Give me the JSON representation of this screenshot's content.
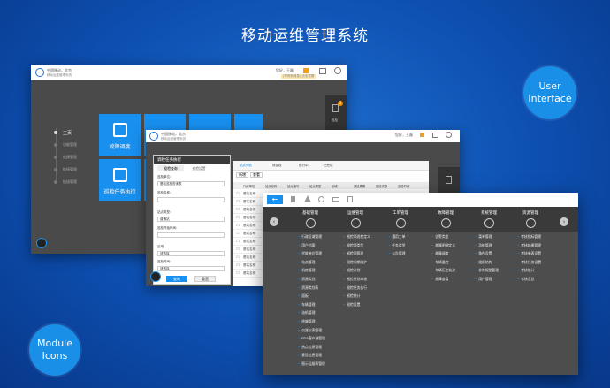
{
  "headline": "移动运维管理系统",
  "bubbles": {
    "ui": [
      "User",
      "Interface"
    ],
    "module": [
      "Module",
      "Icons"
    ]
  },
  "brand": {
    "name": "中国移动，北京",
    "sub": "移动运维管理系统"
  },
  "user": {
    "greeting": "您好，王磊",
    "notice": "(您有新消息) 点击查看"
  },
  "home": {
    "steps": [
      "主页",
      "功能管理",
      "链接管理",
      "链接管理",
      "链接管理"
    ],
    "tiles": [
      {
        "label": "故障调度"
      },
      {
        "label": ""
      },
      {
        "label": ""
      },
      {
        "label": ""
      },
      {
        "label": "巡检任务执行"
      },
      {
        "label": ""
      }
    ],
    "badge": "3",
    "side_label": "巡检"
  },
  "dialog": {
    "title": "调检任务执行",
    "tabs": [
      "巡检查询",
      "巡检设置"
    ],
    "fields": [
      {
        "label": "巡检单位：",
        "value": "基站巡检查询表"
      },
      {
        "label": "巡检名称：",
        "value": ""
      },
      {
        "label": "站点类型：",
        "value": "普通站"
      },
      {
        "label": "巡检开始时间：",
        "value": ""
      },
      {
        "label": "区域：",
        "value": "请选择"
      },
      {
        "label": "巡检时间：",
        "value": "请选择"
      }
    ],
    "query": "查询",
    "reset": "重置"
  },
  "grid": {
    "tabs": [
      "站点列表",
      "待巡检",
      "执行中",
      "已完成"
    ],
    "tools": [
      "新增",
      "查看"
    ],
    "headers": [
      "代维单位",
      "站点名称",
      "站点编号",
      "站点类型",
      "区域",
      "巡检周期",
      "巡检次数",
      "巡检时间"
    ],
    "row_label": "基站名称"
  },
  "menu": {
    "back": "←",
    "categories": [
      {
        "title": "基础管理",
        "items": [
          "行政区域管理",
          "用户档案",
          "代维单位管理",
          "站点管理",
          "机房管理",
          "资源类别",
          "资源类别表",
          "面板",
          "车辆管理",
          "油机管理",
          "终端管理",
          "仪器仪表管理",
          "PDA客户端管理",
          "热点信息管理",
          "意见信息管理",
          "图示运维表管理"
        ]
      },
      {
        "title": "运维管理",
        "items": [
          "巡检项巡检定义",
          "巡检项类型",
          "巡检项管理",
          "巡检周期维护",
          "巡检计划",
          "巡检计划审核",
          "巡检任务执行",
          "巡检统计",
          "巡检设置"
        ]
      },
      {
        "title": "工单管理",
        "items": [
          "通用工单",
          "任务类型",
          "公告管理"
        ]
      },
      {
        "title": "故障管理",
        "items": [
          "告警类型",
          "故障明细定义",
          "故障调度",
          "车辆监控",
          "车辆历史轨迹",
          "故障查看"
        ]
      },
      {
        "title": "系统管理",
        "items": [
          "菜单管理",
          "功能管理",
          "角色设置",
          "组织结构",
          "非常规型管理",
          "用户管理"
        ]
      },
      {
        "title": "资源管理",
        "items": [
          "考核指标管理",
          "考核结果管理",
          "考核单表设置",
          "考核任务设置",
          "考核统计",
          "考核汇总"
        ]
      }
    ]
  },
  "colors": {
    "accent": "#1890f0",
    "bg": "#0d4fb0",
    "window": "#4a4a4a"
  }
}
